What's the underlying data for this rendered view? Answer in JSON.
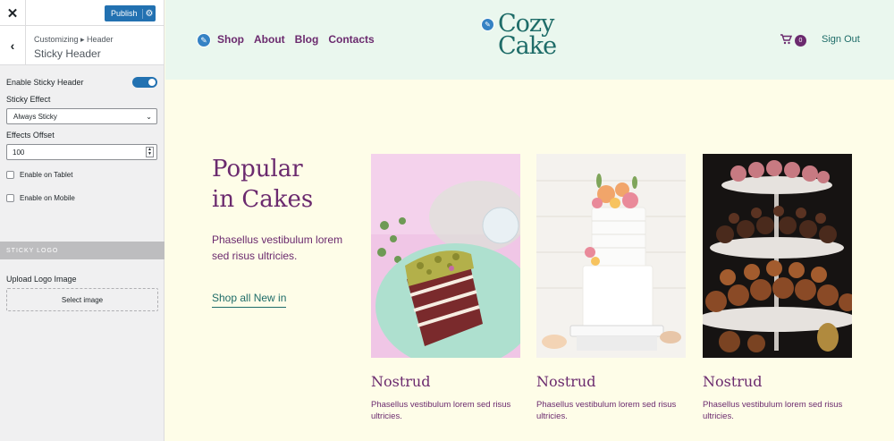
{
  "customizer": {
    "close_glyph": "✕",
    "publish_label": "Publish",
    "breadcrumb": "Customizing ▸ Header",
    "section_title": "Sticky Header",
    "controls": {
      "enable_sticky_label": "Enable Sticky Header",
      "enable_sticky_on": true,
      "sticky_effect_label": "Sticky Effect",
      "sticky_effect_value": "Always Sticky",
      "effects_offset_label": "Effects Offset",
      "effects_offset_value": "100",
      "enable_tablet_label": "Enable on Tablet",
      "enable_mobile_label": "Enable on Mobile"
    },
    "sticky_logo_group": "STICKY LOGO",
    "upload_logo_label": "Upload Logo Image",
    "select_image_label": "Select image",
    "accent_color": "#2271b1"
  },
  "site": {
    "nav": [
      "Shop",
      "About",
      "Blog",
      "Contacts"
    ],
    "logo_line1": "Cozy",
    "logo_line2": "Cake",
    "cart_count": "0",
    "signout": "Sign Out",
    "hero": {
      "title_line1": "Popular",
      "title_line2": "in Cakes",
      "text": "Phasellus vestibulum lorem sed risus ultricies.",
      "link": "Shop all New in"
    },
    "products": [
      {
        "title": "Nostrud",
        "desc": "Phasellus vestibulum lorem sed risus ultricies."
      },
      {
        "title": "Nostrud",
        "desc": "Phasellus vestibulum lorem sed risus ultricies."
      },
      {
        "title": "Nostrud",
        "desc": "Phasellus vestibulum lorem sed risus ultricies."
      }
    ],
    "colors": {
      "primary": "#6b2a6e",
      "teal": "#1e6c68",
      "header_bg": "#eaf7ee",
      "page_bg": "#fefde8"
    }
  }
}
